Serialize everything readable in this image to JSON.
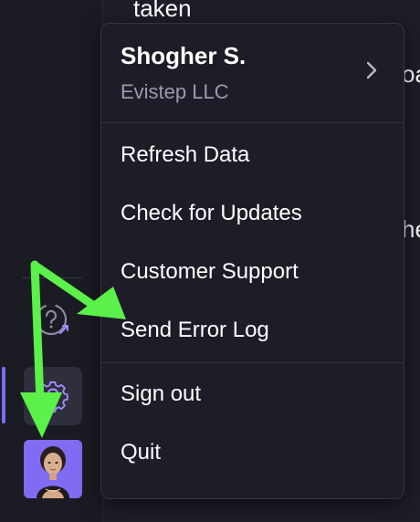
{
  "background": {
    "top_text": "taken",
    "right_fragment_1": "oa",
    "right_fragment_2": "he"
  },
  "menu": {
    "user_name": "Shogher S.",
    "company": "Evistep LLC",
    "items": [
      {
        "label": "Refresh Data"
      },
      {
        "label": "Check for Updates"
      },
      {
        "label": "Customer Support"
      },
      {
        "label": "Send Error Log"
      },
      {
        "label": "Sign out"
      },
      {
        "label": "Quit"
      }
    ]
  },
  "sidebar": {
    "help_icon": "question-mark-icon",
    "settings_icon": "gear-icon",
    "avatar": "user-avatar"
  },
  "colors": {
    "accent": "#7b6bff",
    "annotation": "#5cf04a",
    "menu_bg": "#1d1c27",
    "muted_text": "#9b9aae"
  }
}
